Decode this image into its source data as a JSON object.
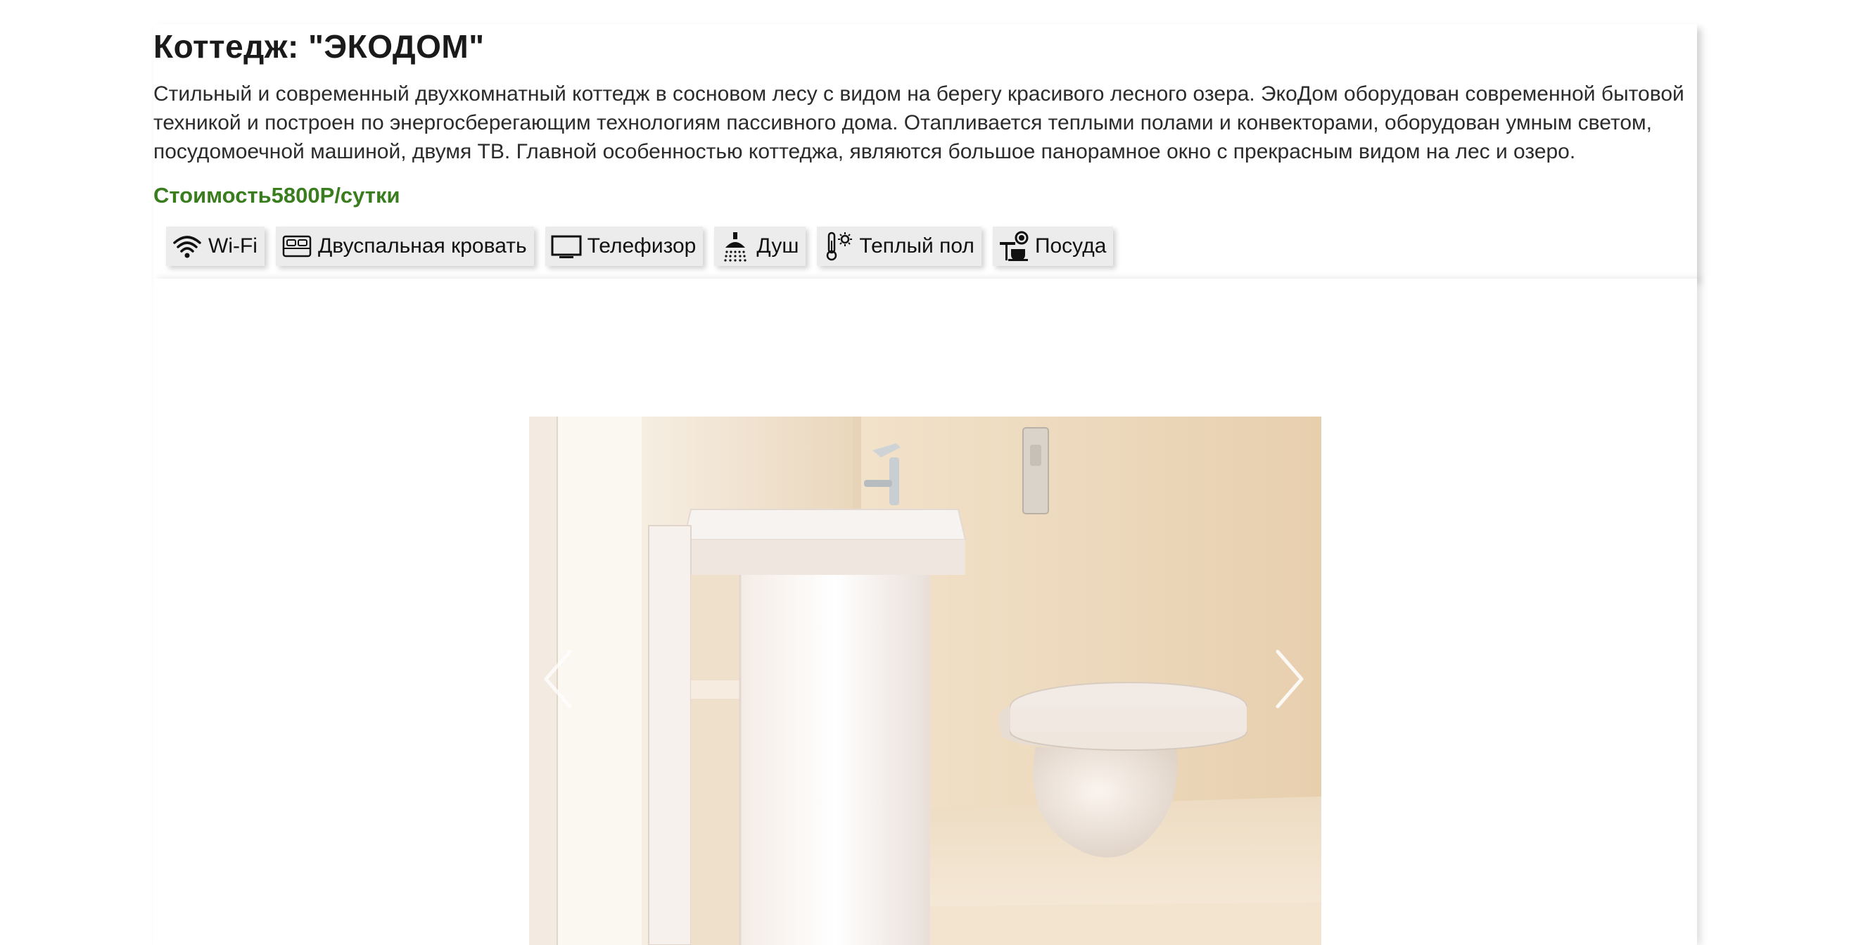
{
  "cottage": {
    "title": "Коттедж: \"ЭКОДОМ\"",
    "description": "Стильный и современный двухкомнатный коттедж в сосновом лесу с видом на берегу красивого лесного озера. ЭкоДом оборудован современной бытовой техникой и построен по энергосберегающим технологиям пассивного дома. Отапливается теплыми полами и конвекторами, оборудован умным светом, посудомоечной машиной, двумя ТВ. Главной особенностью коттеджа, являются большое панорамное окно с прекрасным видом на лес и озеро.",
    "price": "Стоимость5800Р/сутки",
    "price_color": "#3a7d1e"
  },
  "amenities": [
    {
      "label": "Wi-Fi",
      "icon": "wifi-icon"
    },
    {
      "label": "Двуспальная кровать",
      "icon": "bed-icon"
    },
    {
      "label": "Телефизор",
      "icon": "tv-icon"
    },
    {
      "label": "Душ",
      "icon": "shower-icon"
    },
    {
      "label": "Теплый пол",
      "icon": "thermometer-icon"
    },
    {
      "label": "Посуда",
      "icon": "dishes-icon"
    }
  ],
  "gallery": {
    "prev_icon": "chevron-left-icon",
    "next_icon": "chevron-right-icon"
  }
}
